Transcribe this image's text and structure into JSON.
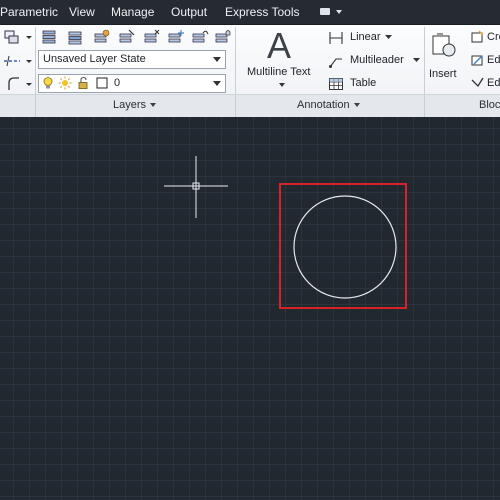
{
  "menu": {
    "items": [
      "Parametric",
      "View",
      "Manage",
      "Output",
      "Express Tools"
    ]
  },
  "ribbon": {
    "layers": {
      "title": "Layers",
      "layer_state": "Unsaved Layer State",
      "current_layer": "0"
    },
    "annotation": {
      "title": "Annotation",
      "multiline_text_label": "Multiline Text",
      "big_glyph": "A",
      "linear_label": "Linear",
      "multileader_label": "Multileader",
      "table_label": "Table"
    },
    "block": {
      "title": "Bloc",
      "insert_label": "Insert",
      "create_label": "Cre",
      "edit_label": "Edi",
      "edit_attr_label": "Edi"
    }
  },
  "colors": {
    "canvas_bg": "#212830",
    "grid": "#2b333d",
    "selection": "#d8222a",
    "crosshair": "#e8ecef",
    "circle": "#e6e9ec"
  }
}
